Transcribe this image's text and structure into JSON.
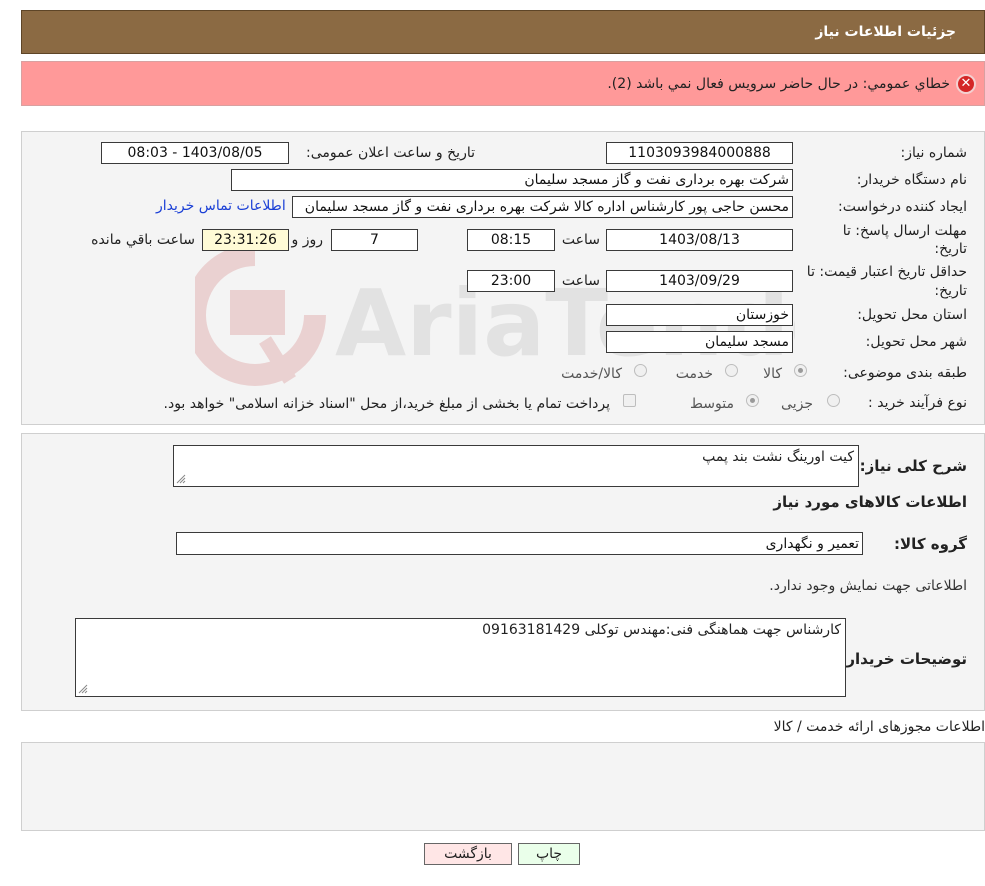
{
  "header": {
    "title": "جزئیات اطلاعات نیاز"
  },
  "error": {
    "icon": "error-x-icon",
    "message": "خطاي عمومي: در حال حاضر سرويس فعال نمي باشد (2)."
  },
  "form": {
    "need_number_label": "شماره نیاز:",
    "need_number": "1103093984000888",
    "announce_label": "تاریخ و ساعت اعلان عمومی:",
    "announce_value": "1403/08/05 - 08:03",
    "buyer_org_label": "نام دستگاه خریدار:",
    "buyer_org": "شرکت بهره برداری نفت و گاز مسجد سلیمان",
    "creator_label": "ایجاد کننده درخواست:",
    "creator": "محسن حاجی پور کارشناس اداره کالا  شرکت بهره برداری نفت و گاز مسجد سلیمان",
    "contact_link": "اطلاعات تماس خریدار",
    "deadline_label_1": "مهلت ارسال پاسخ: تا",
    "deadline_label_2": "تاریخ:",
    "deadline_date": "1403/08/13",
    "time_label": "ساعت",
    "deadline_time": "08:15",
    "days_value": "7",
    "days_label": "روز و",
    "remaining_time": "23:31:26",
    "remaining_label": "ساعت باقي مانده",
    "validity_label_1": "حداقل تاریخ اعتبار قیمت: تا",
    "validity_label_2": "تاریخ:",
    "validity_date": "1403/09/29",
    "validity_time": "23:00",
    "province_label": "استان محل تحویل:",
    "province": "خوزستان",
    "city_label": "شهر محل تحویل:",
    "city": "مسجد سلیمان",
    "category_label": "طبقه بندی موضوعی:",
    "category_options": [
      "کالا",
      "خدمت",
      "کالا/خدمت"
    ],
    "process_label": "نوع فرآیند خرید :",
    "process_options": [
      "جزیی",
      "متوسط"
    ],
    "payment_note": "پرداخت تمام یا بخشی از مبلغ خرید،از محل \"اسناد خزانه اسلامی\" خواهد بود."
  },
  "details": {
    "summary_label": "شرح کلی نیاز:",
    "summary": "کیت اورینگ نشت بند پمپ",
    "goods_title": "اطلاعات کالاهای مورد نیاز",
    "group_label": "گروه کالا:",
    "group": "تعمیر و نگهداری",
    "no_info": "اطلاعاتی جهت نمایش وجود ندارد.",
    "buyer_notes_label": "توضیحات خریدار:",
    "buyer_notes": "کارشناس جهت هماهنگی فنی:مهندس توکلی 09163181429"
  },
  "permits": {
    "title": "اطلاعات مجوزهای ارائه خدمت / کالا"
  },
  "buttons": {
    "print": "چاپ",
    "back": "بازگشت"
  },
  "colors": {
    "header_bg": "#8b6a43",
    "error_bg": "#ff9999",
    "print_bg": "#eaffea",
    "back_bg": "#ffe6e6",
    "link": "#1a3fd6"
  }
}
